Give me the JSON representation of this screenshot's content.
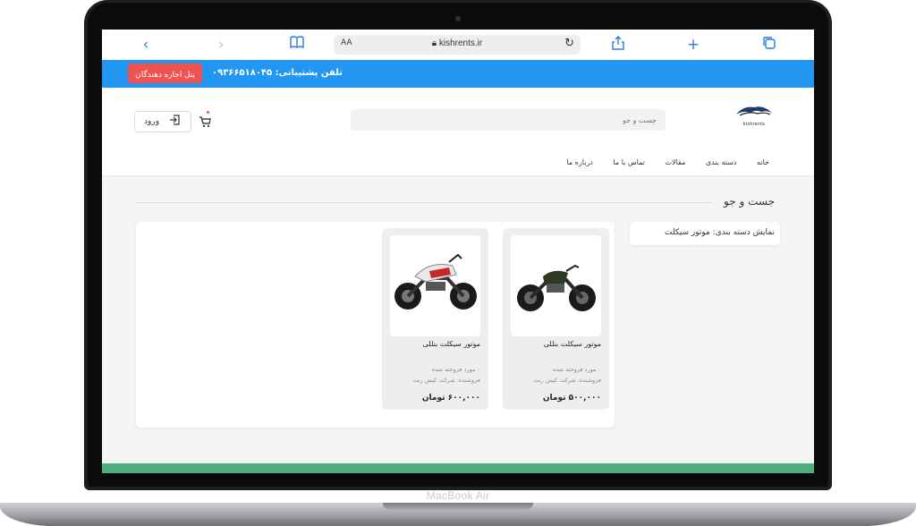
{
  "device": {
    "brand_label": "MacBook Air"
  },
  "browser": {
    "url_text": "kishrents.ir",
    "reader_label": "AA",
    "icons": {
      "back": "chevron-left-icon",
      "forward": "chevron-right-icon",
      "bookmarks": "book-icon",
      "lock": "lock-icon",
      "reload": "reload-icon",
      "share": "share-icon",
      "new_tab": "plus-icon",
      "tabs": "tabs-icon"
    }
  },
  "topbar": {
    "panel_button": "پنل اجاره دهندگان",
    "support_text": "تلفن پشتیبانی: ۰۹۳۶۶۵۱۸۰۴۵",
    "bg_color": "#2196f3",
    "panel_color": "#ef5350"
  },
  "header": {
    "logo_text": "kishrents",
    "search_placeholder": "جست و جو",
    "login_label": "ورود",
    "nav": [
      "خانه",
      "دسته بندی",
      "مقالات",
      "تماس با ما",
      "درباره ما"
    ]
  },
  "main": {
    "title": "جست و جو",
    "filter_text": "نمایش دسته بندی: موتور سیکلت",
    "products": [
      {
        "name": "موتور سیکلت بنللی",
        "sold": "۰ مورد فروخته شده",
        "seller": "فروشنده: شرکت کیش رنت",
        "price": "۵۰۰,۰۰۰ تومان"
      },
      {
        "name": "موتور سیکلت بنللی",
        "sold": "۰ مورد فروخته شده",
        "seller": "فروشنده: شرکت کیش رنت",
        "price": "۶۰۰,۰۰۰ تومان"
      }
    ]
  },
  "footer": {
    "bar_color": "#4caf7d"
  }
}
